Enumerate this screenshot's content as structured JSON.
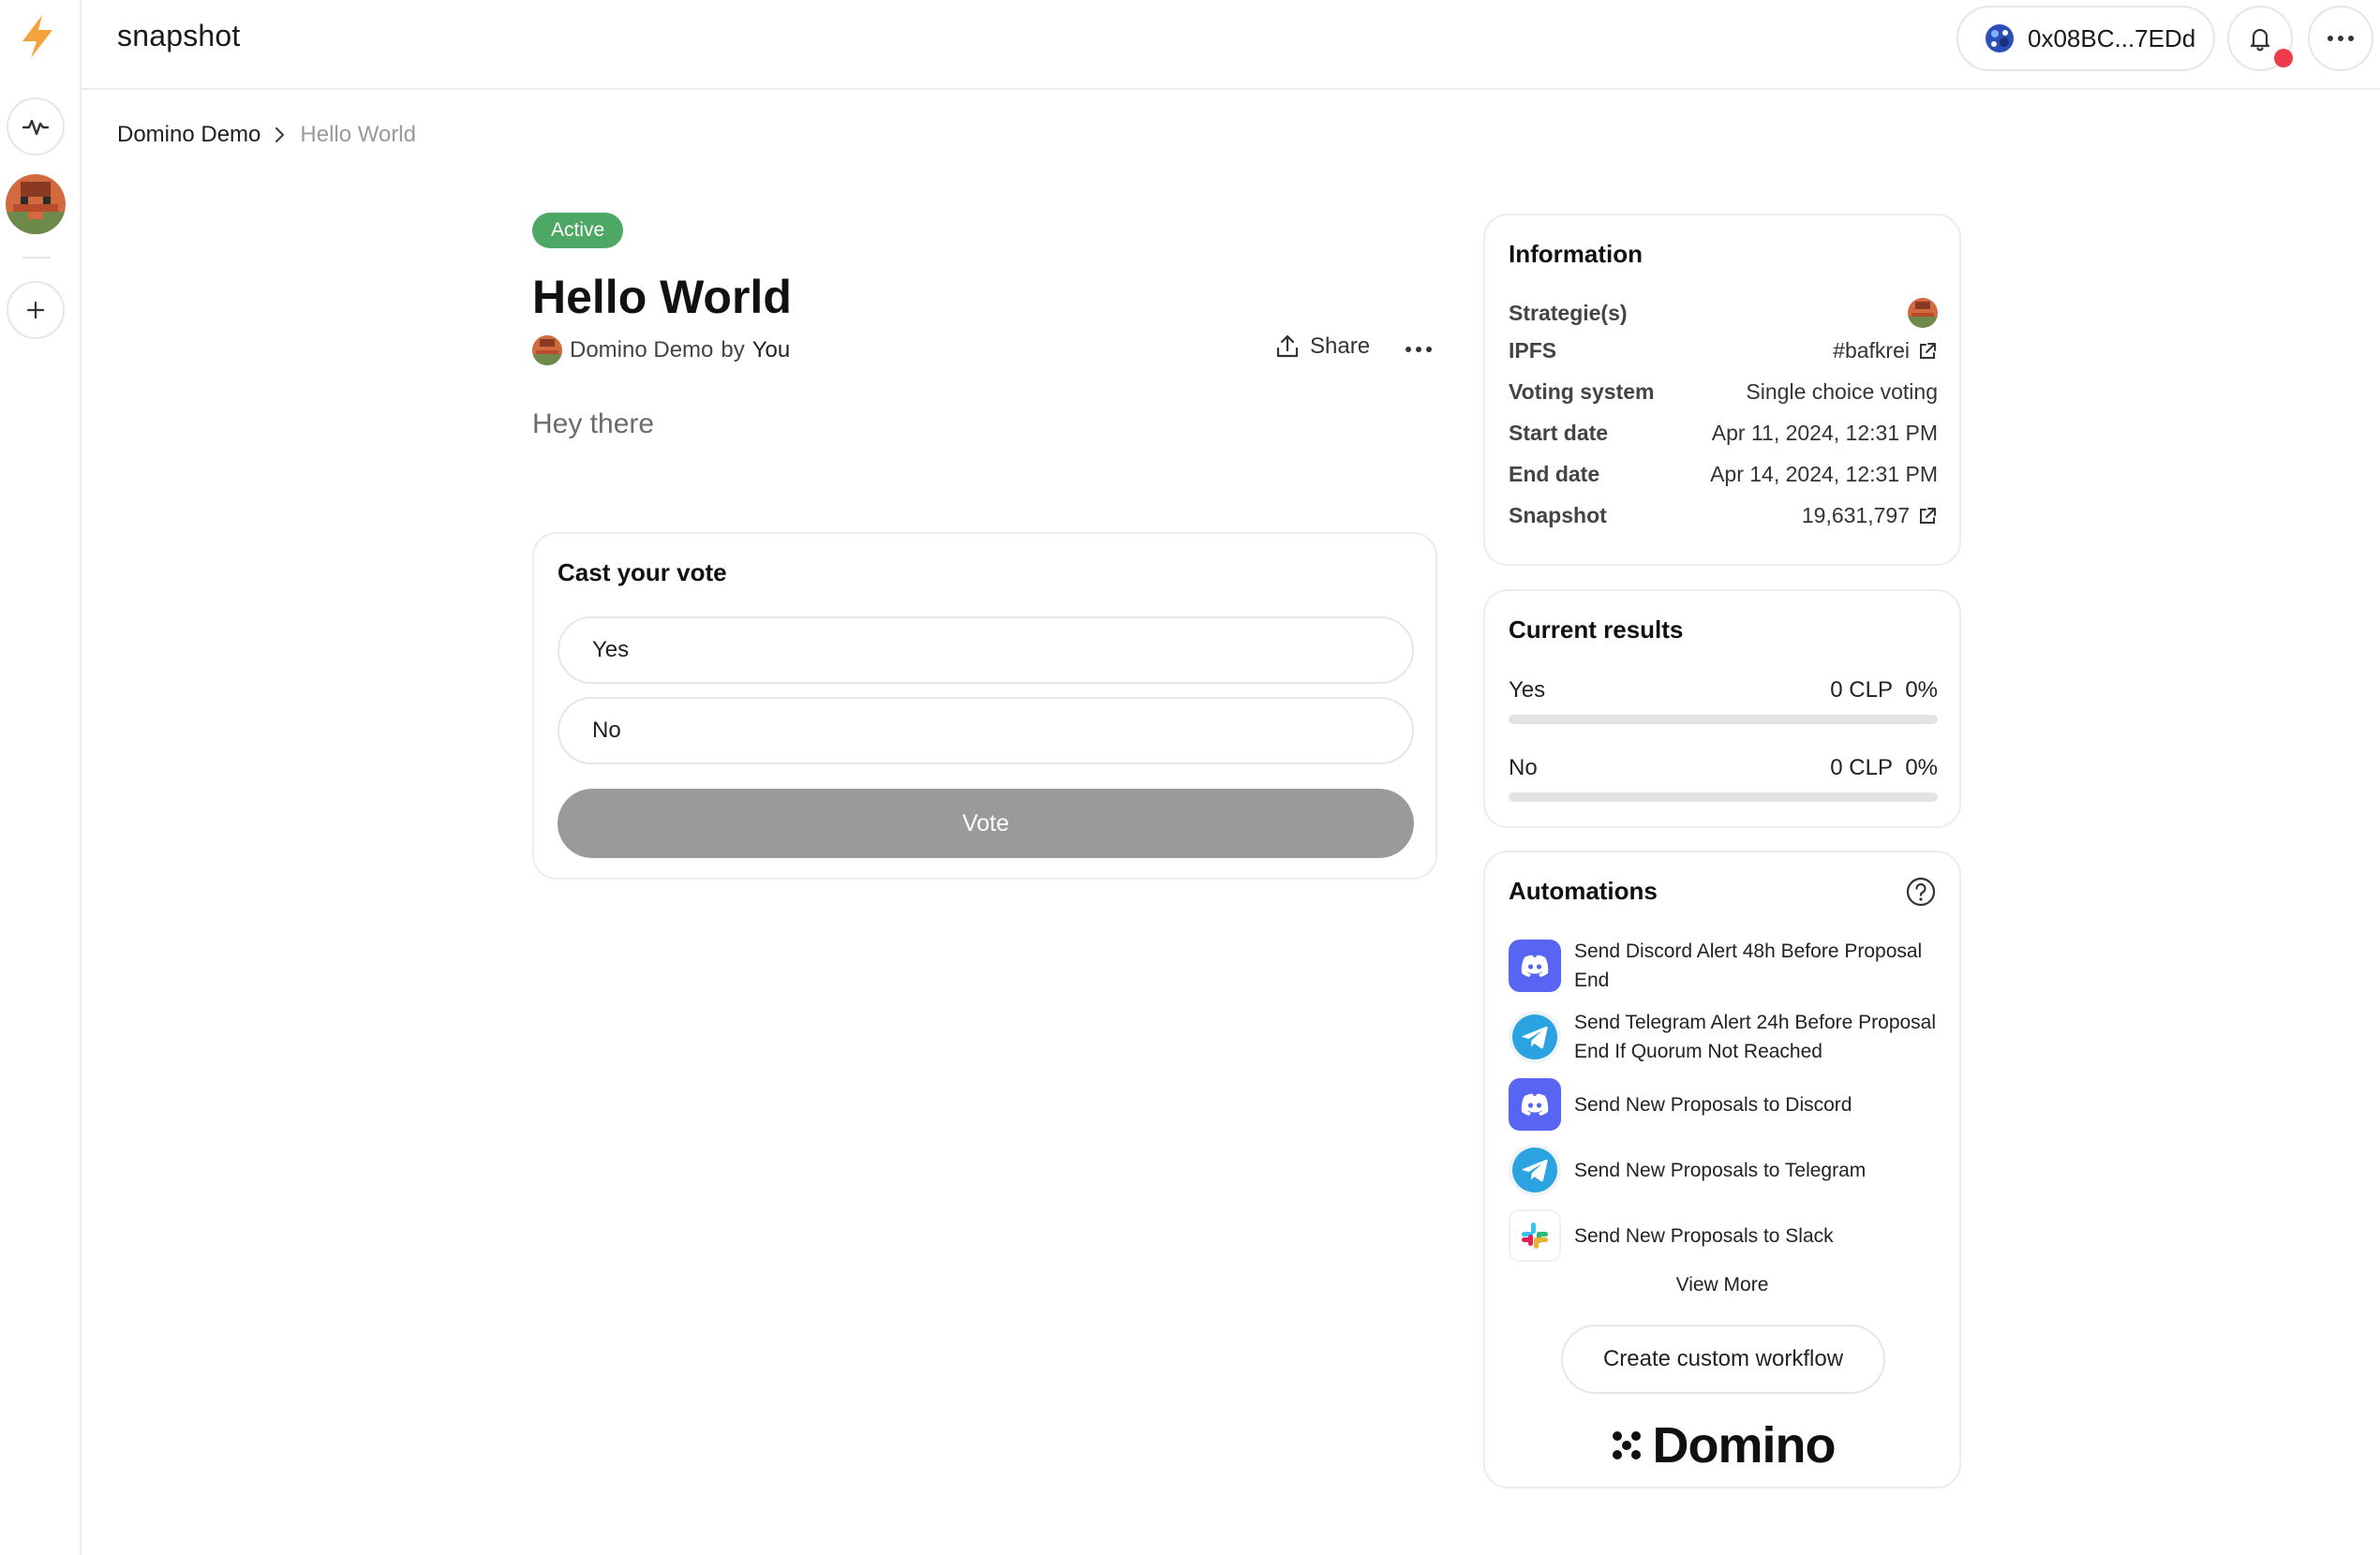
{
  "header": {
    "brand": "snapshot",
    "account": "0x08BC...7EDd"
  },
  "breadcrumb": {
    "parent": "Domino Demo",
    "current": "Hello World"
  },
  "proposal": {
    "status": "Active",
    "title": "Hello World",
    "space": "Domino Demo",
    "by": "by",
    "author": "You",
    "share_label": "Share",
    "body": "Hey there"
  },
  "vote": {
    "title": "Cast your vote",
    "choices": [
      "Yes",
      "No"
    ],
    "button": "Vote"
  },
  "information": {
    "title": "Information",
    "rows": [
      {
        "label": "Strategie(s)",
        "value": ""
      },
      {
        "label": "IPFS",
        "value": "#bafkrei"
      },
      {
        "label": "Voting system",
        "value": "Single choice voting"
      },
      {
        "label": "Start date",
        "value": "Apr 11, 2024, 12:31 PM"
      },
      {
        "label": "End date",
        "value": "Apr 14, 2024, 12:31 PM"
      },
      {
        "label": "Snapshot",
        "value": "19,631,797"
      }
    ]
  },
  "results": {
    "title": "Current results",
    "items": [
      {
        "label": "Yes",
        "amount": "0 CLP",
        "percent": "0%",
        "fraction": 0
      },
      {
        "label": "No",
        "amount": "0 CLP",
        "percent": "0%",
        "fraction": 0
      }
    ]
  },
  "automations": {
    "title": "Automations",
    "items": [
      {
        "label": "Send Discord Alert 48h Before Proposal End",
        "icon": "discord-icon"
      },
      {
        "label": "Send Telegram Alert 24h Before Proposal End If Quorum Not Reached",
        "icon": "telegram-icon"
      },
      {
        "label": "Send New Proposals to Discord",
        "icon": "discord-icon"
      },
      {
        "label": "Send New Proposals to Telegram",
        "icon": "telegram-icon"
      },
      {
        "label": "Send New Proposals to Slack",
        "icon": "slack-icon"
      }
    ],
    "view_more": "View More",
    "custom_button": "Create custom workflow",
    "brand": "Domino"
  },
  "colors": {
    "active_badge": "#4ea865",
    "vote_button": "#9a9a9a",
    "notification_dot": "#ec3b4b",
    "discord": "#5865f2",
    "telegram": "#2aa3e0",
    "snapshot_bolt": "#f3a33a"
  }
}
